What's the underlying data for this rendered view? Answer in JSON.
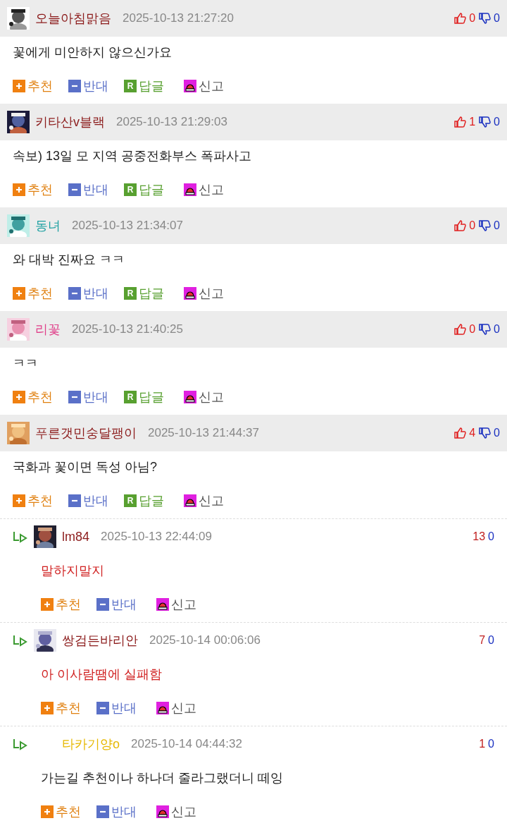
{
  "comments": [
    {
      "kind": "comment",
      "has_avatar": true,
      "author": "오늘아침맑음",
      "color": "#8b1a1a",
      "date": "2025-10-13 21:27:20",
      "up": "0",
      "down": "0",
      "text": "꽃에게 미안하지 않으신가요",
      "highlighted": false,
      "actions": [
        {
          "kind": "up",
          "label": "추천"
        },
        {
          "kind": "down",
          "label": "반대"
        },
        {
          "kind": "reply",
          "icon_text": "R",
          "label": "답글"
        },
        {
          "kind": "report",
          "label": "신고"
        }
      ]
    },
    {
      "kind": "comment",
      "has_avatar": true,
      "author": "키타산v블랙",
      "color": "#8b1a1a",
      "date": "2025-10-13 21:29:03",
      "up": "1",
      "down": "0",
      "text": "속보) 13일 모 지역 공중전화부스 폭파사고",
      "highlighted": false,
      "actions": [
        {
          "kind": "up",
          "label": "추천"
        },
        {
          "kind": "down",
          "label": "반대"
        },
        {
          "kind": "reply",
          "icon_text": "R",
          "label": "답글"
        },
        {
          "kind": "report",
          "label": "신고"
        }
      ]
    },
    {
      "kind": "comment",
      "has_avatar": true,
      "author": "동녀",
      "color": "#1a9fa0",
      "date": "2025-10-13 21:34:07",
      "up": "0",
      "down": "0",
      "text": "와 대박 진짜요 ㅋㅋ",
      "highlighted": false,
      "actions": [
        {
          "kind": "up",
          "label": "추천"
        },
        {
          "kind": "down",
          "label": "반대"
        },
        {
          "kind": "reply",
          "icon_text": "R",
          "label": "답글"
        },
        {
          "kind": "report",
          "label": "신고"
        }
      ]
    },
    {
      "kind": "comment",
      "has_avatar": true,
      "author": "리꽃",
      "color": "#e0408a",
      "date": "2025-10-13 21:40:25",
      "up": "0",
      "down": "0",
      "text": "ㅋㅋ",
      "highlighted": false,
      "actions": [
        {
          "kind": "up",
          "label": "추천"
        },
        {
          "kind": "down",
          "label": "반대"
        },
        {
          "kind": "reply",
          "icon_text": "R",
          "label": "답글"
        },
        {
          "kind": "report",
          "label": "신고"
        }
      ]
    },
    {
      "kind": "comment",
      "has_avatar": true,
      "author": "푸른갯민숭달팽이",
      "color": "#8b1a1a",
      "date": "2025-10-13 21:44:37",
      "up": "4",
      "down": "0",
      "text": "국화과 꽃이면 독성 아님?",
      "highlighted": false,
      "actions": [
        {
          "kind": "up",
          "label": "추천"
        },
        {
          "kind": "down",
          "label": "반대"
        },
        {
          "kind": "reply",
          "icon_text": "R",
          "label": "답글"
        },
        {
          "kind": "report",
          "label": "신고"
        }
      ]
    },
    {
      "kind": "reply",
      "has_avatar": true,
      "author": "lm84",
      "color": "#8b1a1a",
      "date": "2025-10-13 22:44:09",
      "up": "13",
      "down": "0",
      "text": "말하지말지",
      "highlighted": true,
      "actions": [
        {
          "kind": "up",
          "label": "추천"
        },
        {
          "kind": "down",
          "label": "반대"
        },
        {
          "kind": "report",
          "label": "신고"
        }
      ]
    },
    {
      "kind": "reply",
      "has_avatar": true,
      "author": "쌍검든바리안",
      "color": "#8b1a1a",
      "date": "2025-10-14 00:06:06",
      "up": "7",
      "down": "0",
      "text": "아 이사람땜에 실패함",
      "highlighted": true,
      "actions": [
        {
          "kind": "up",
          "label": "추천"
        },
        {
          "kind": "down",
          "label": "반대"
        },
        {
          "kind": "report",
          "label": "신고"
        }
      ]
    },
    {
      "kind": "reply",
      "has_avatar": false,
      "author": "타카기양o",
      "color": "#e6b800",
      "date": "2025-10-14 04:44:32",
      "up": "1",
      "down": "0",
      "text": "가는길 추천이나 하나더 줄라그랬더니 떼잉",
      "highlighted": false,
      "actions": [
        {
          "kind": "up",
          "label": "추천"
        },
        {
          "kind": "down",
          "label": "반대"
        },
        {
          "kind": "report",
          "label": "신고"
        }
      ]
    }
  ]
}
